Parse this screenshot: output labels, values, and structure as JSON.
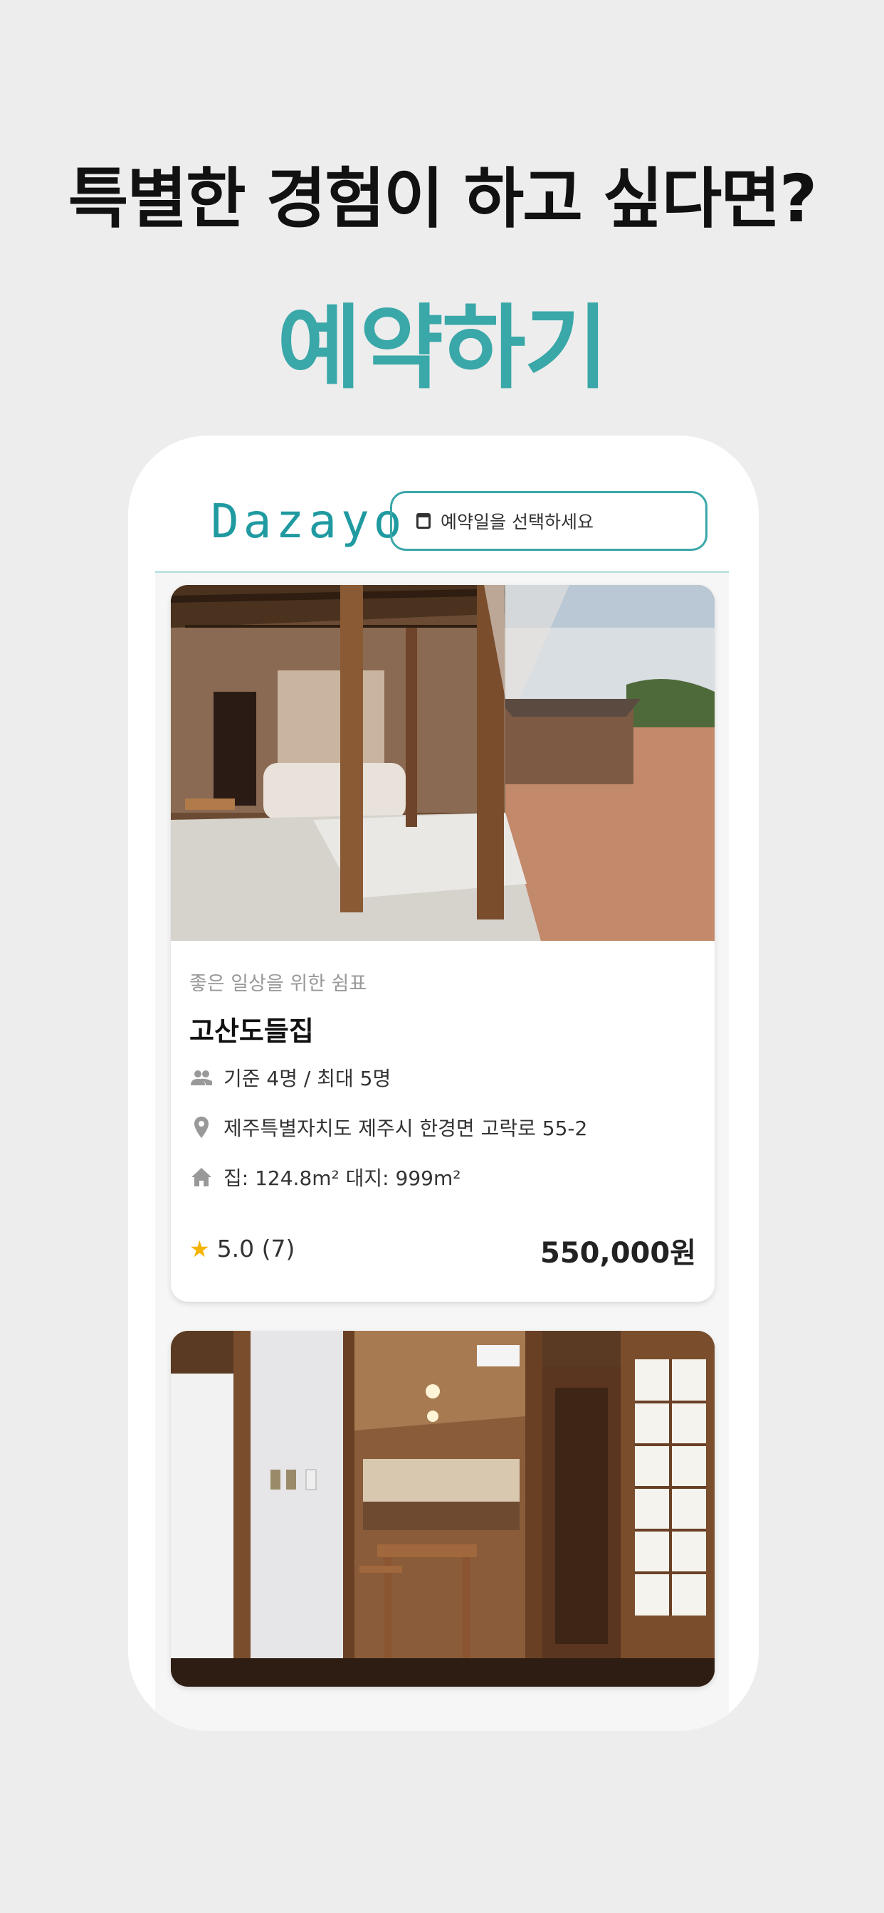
{
  "promo": {
    "headline": "특별한 경험이 하고 싶다면?",
    "subheadline": "예약하기"
  },
  "app": {
    "logo": "Dazayo",
    "accent_color": "#3aa7a8",
    "date_picker": {
      "icon": "calendar-icon",
      "placeholder": "예약일을 선택하세요"
    }
  },
  "listings": [
    {
      "tagline": "좋은 일상을 위한 쉼표",
      "name": "고산도들집",
      "capacity": "기준 4명 / 최대 5명",
      "address": "제주특별자치도 제주시 한경면 고락로 55-2",
      "size": "집: 124.8m²    대지: 999m²",
      "rating": "5.0 (7)",
      "price": "550,000원"
    },
    {}
  ]
}
